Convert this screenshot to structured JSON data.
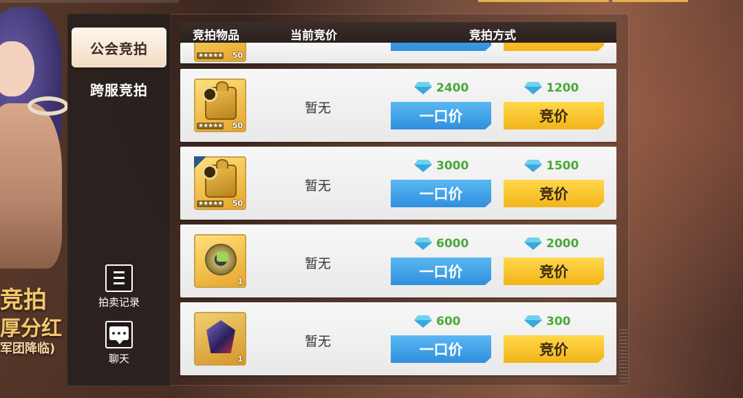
{
  "sidebar": {
    "tabs": [
      {
        "label": "公会竞拍",
        "active": true
      },
      {
        "label": "跨服竞拍",
        "active": false
      }
    ],
    "records_label": "拍卖记录",
    "chat_label": "聊天"
  },
  "promo": {
    "line1": "竞拍",
    "line2": "厚分红",
    "line3": "军团降临)"
  },
  "table": {
    "headers": {
      "item": "竞拍物品",
      "current_bid": "当前竞价",
      "method": "竞拍方式"
    },
    "buy_label": "一口价",
    "bid_label": "竞价",
    "rows": [
      {
        "item_icon": "puzzle-emblem-icon",
        "stars": "★★★★★",
        "quantity": "50",
        "current_bid": "暂无",
        "buyout_price": "2400",
        "bid_price": "1200"
      },
      {
        "item_icon": "puzzle-emblem-icon",
        "stars": "★★★★★",
        "quantity": "50",
        "current_bid": "暂无",
        "buyout_price": "3000",
        "bid_price": "1500"
      },
      {
        "item_icon": "gadget-icon",
        "stars": "",
        "quantity": "1",
        "current_bid": "暂无",
        "buyout_price": "6000",
        "bid_price": "2000"
      },
      {
        "item_icon": "gem-icon",
        "stars": "",
        "quantity": "1",
        "current_bid": "暂无",
        "buyout_price": "600",
        "bid_price": "300"
      }
    ],
    "partial_row": {
      "stars": "★★★★★",
      "quantity": "50"
    }
  },
  "colors": {
    "buy_button": "#3a9fe6",
    "bid_button": "#f7c42a",
    "price_text": "#4aa83a",
    "active_tab": "#f6e7d6"
  }
}
